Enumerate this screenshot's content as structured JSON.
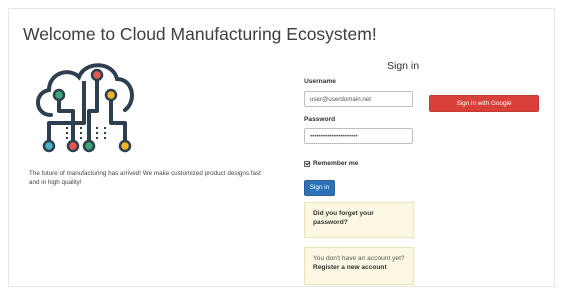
{
  "header": {
    "title": "Welcome to Cloud Manufacturing Ecosystem!"
  },
  "intro": {
    "tagline": "The future of manufacturing has arrived! We make customized product designs fast and in high quality!",
    "logo_icon": "cloud-circuit-icon",
    "colors": {
      "outline": "#2e3f4f",
      "red": "#e8574f",
      "green": "#3aa776",
      "yellow": "#f0b429",
      "teal": "#4ab3c5"
    }
  },
  "signin": {
    "heading": "Sign in",
    "username_label": "Username",
    "username_value": "user@userdomain.net",
    "password_label": "Password",
    "password_value": "••••••••••••••••••••••",
    "remember_label": "Remember me",
    "remember_checked": true,
    "submit_label": "Sign in",
    "google_label": "Sign in with Google",
    "google_color": "#d9403a",
    "submit_color": "#2d72b5"
  },
  "links": {
    "forgot_password": "Did you forget your password?",
    "no_account_prefix": "You don't have an account yet?",
    "register_label": "Register a new account"
  }
}
